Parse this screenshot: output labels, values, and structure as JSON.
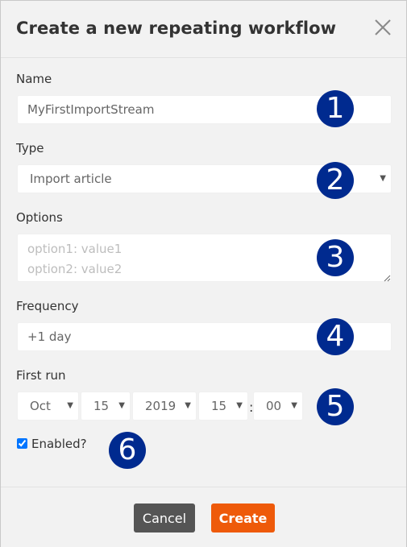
{
  "dialog": {
    "title": "Create a new repeating workflow",
    "close_icon": "close-icon"
  },
  "form": {
    "name": {
      "label": "Name",
      "value": "MyFirstImportStream"
    },
    "type": {
      "label": "Type",
      "selected": "Import article"
    },
    "options": {
      "label": "Options",
      "placeholder": "option1: value1\noption2: value2"
    },
    "frequency": {
      "label": "Frequency",
      "value": "+1 day"
    },
    "first_run": {
      "label": "First run",
      "month": "Oct",
      "day": "15",
      "year": "2019",
      "hour": "15",
      "separator": ":",
      "minute": "00"
    },
    "enabled": {
      "label": "Enabled?",
      "checked": true
    }
  },
  "annotations": [
    "1",
    "2",
    "3",
    "4",
    "5",
    "6"
  ],
  "footer": {
    "cancel_label": "Cancel",
    "create_label": "Create"
  },
  "colors": {
    "badge": "#002a8f",
    "create_button": "#ee5a0a",
    "cancel_button": "#555555"
  }
}
